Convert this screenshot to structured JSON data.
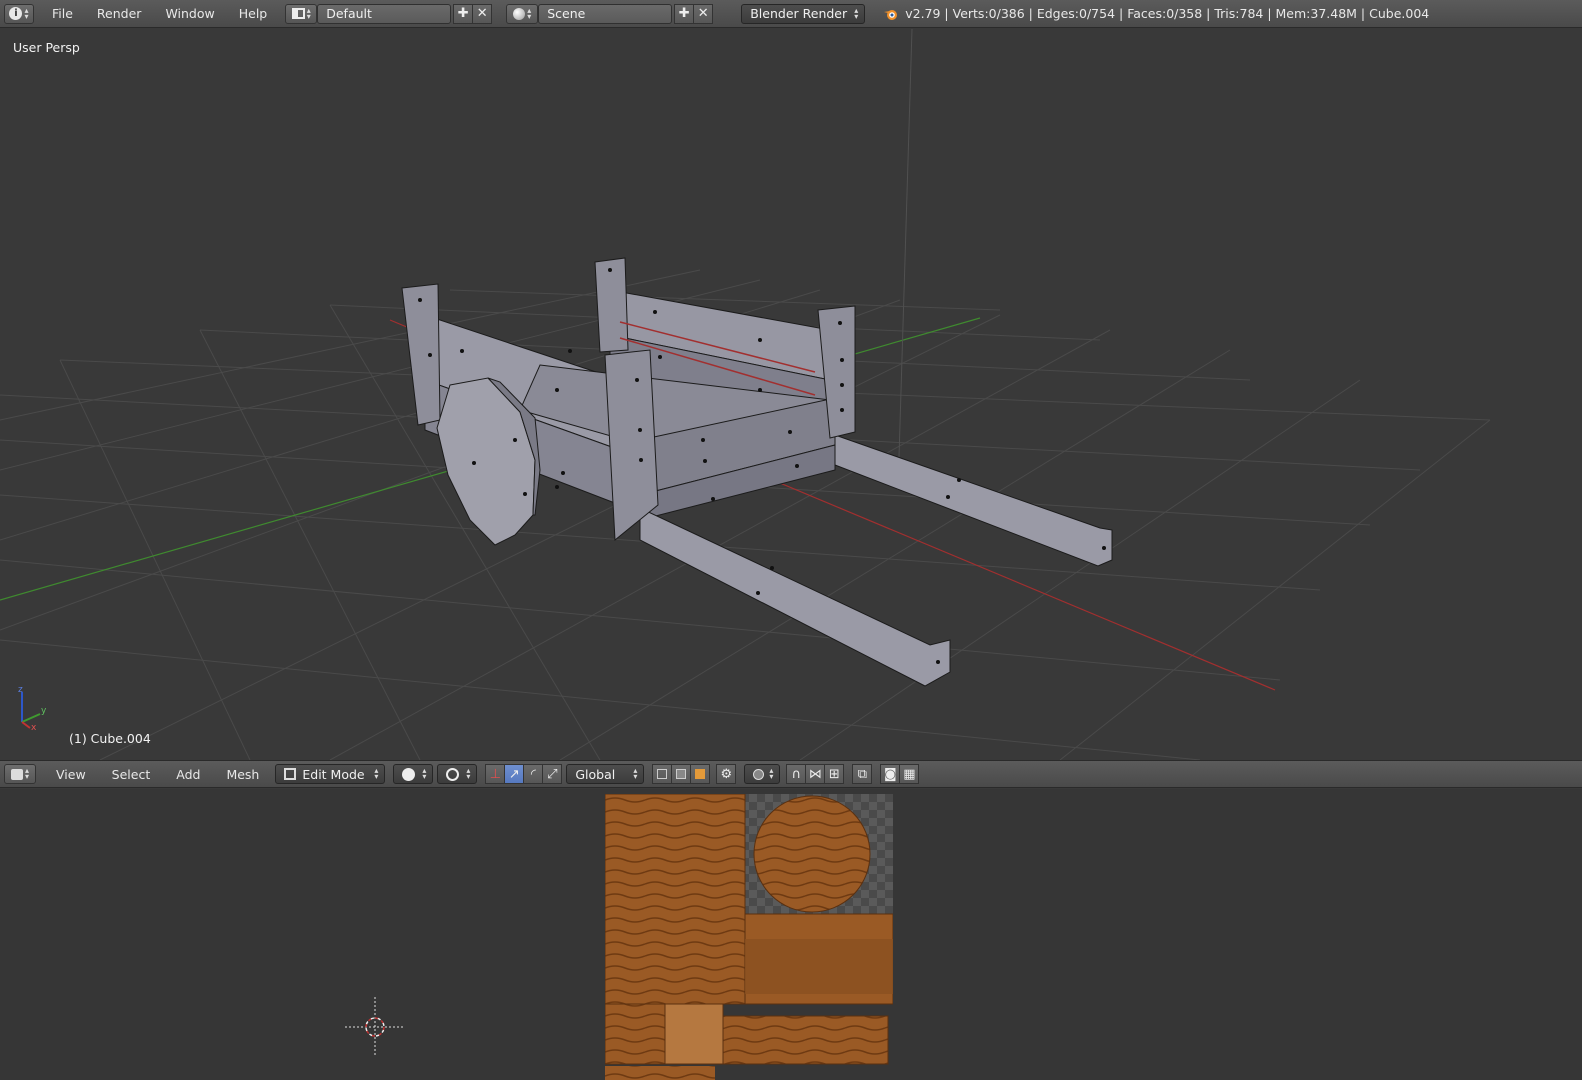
{
  "topbar": {
    "menu": [
      "File",
      "Render",
      "Window",
      "Help"
    ],
    "screen_layout": "Default",
    "scene": "Scene",
    "render_engine": "Blender Render",
    "stats": "v2.79 | Verts:0/386 | Edges:0/754 | Faces:0/358 | Tris:784 | Mem:37.48M | Cube.004"
  },
  "viewport": {
    "view_label": "User Persp",
    "object_label": "(1) Cube.004",
    "axis_labels": {
      "x": "x",
      "y": "y",
      "z": "z"
    }
  },
  "viewport_header": {
    "menu": [
      "View",
      "Select",
      "Add",
      "Mesh"
    ],
    "mode": "Edit Mode",
    "orientation": "Global"
  },
  "icons": {
    "info": "info-icon",
    "screen": "screen-layout-icon",
    "scene": "scene-icon",
    "blender_logo": "blender-logo-icon",
    "editor_type": "editor-type-3d-icon",
    "viewport_shading": "solid-shading-icon",
    "pivot": "pivot-point-icon",
    "manipulator": "manipulator-icon",
    "cursor": "3d-cursor-icon"
  },
  "colors": {
    "header_bg": "#4f4f4f",
    "viewport_bg": "#393939",
    "x_axis": "#a22f2f",
    "y_axis": "#3f8a2f",
    "mesh_face": "#8e8e9a",
    "active_blue": "#5679c0",
    "wood": "#9a5a25"
  }
}
